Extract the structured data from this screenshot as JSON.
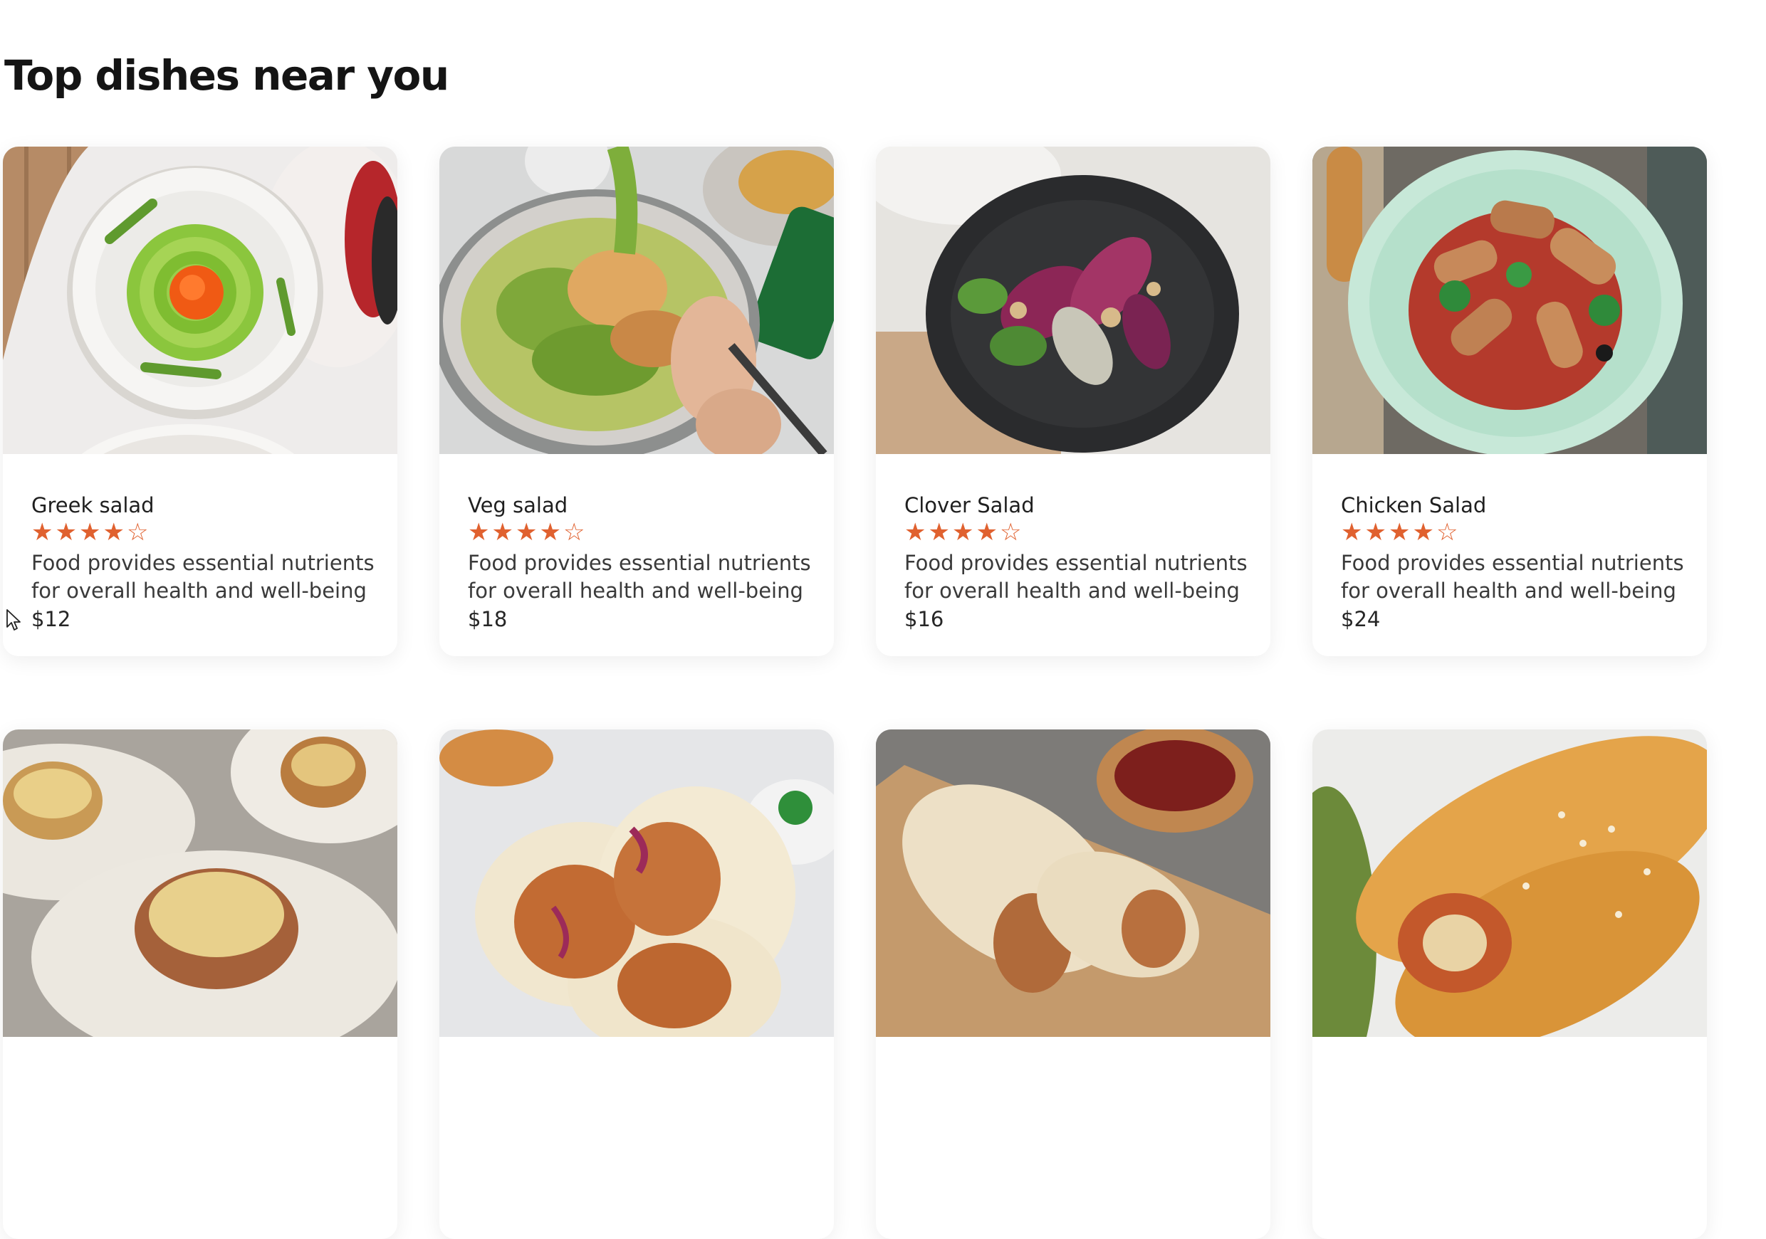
{
  "section": {
    "title": "Top dishes near you"
  },
  "dishes": [
    {
      "name": "Greek salad",
      "rating": 4,
      "description": "Food provides essential nutrients for overall health and well-being",
      "price": "$12",
      "image": "greek-salad-photo"
    },
    {
      "name": "Veg salad",
      "rating": 4,
      "description": "Food provides essential nutrients for overall health and well-being",
      "price": "$18",
      "image": "veg-salad-photo"
    },
    {
      "name": "Clover Salad",
      "rating": 4,
      "description": "Food provides essential nutrients for overall health and well-being",
      "price": "$16",
      "image": "clover-salad-photo"
    },
    {
      "name": "Chicken Salad",
      "rating": 4,
      "description": "Food provides essential nutrients for overall health and well-being",
      "price": "$24",
      "image": "chicken-salad-photo"
    },
    {
      "image": "lasagna-rolls-photo"
    },
    {
      "image": "chicken-wraps-photo"
    },
    {
      "image": "burrito-wrap-photo"
    },
    {
      "image": "sesame-rolls-photo"
    }
  ],
  "rating_max": 5,
  "colors": {
    "star": "#e0612f",
    "title": "#141414",
    "text": "#3a3a3a"
  }
}
